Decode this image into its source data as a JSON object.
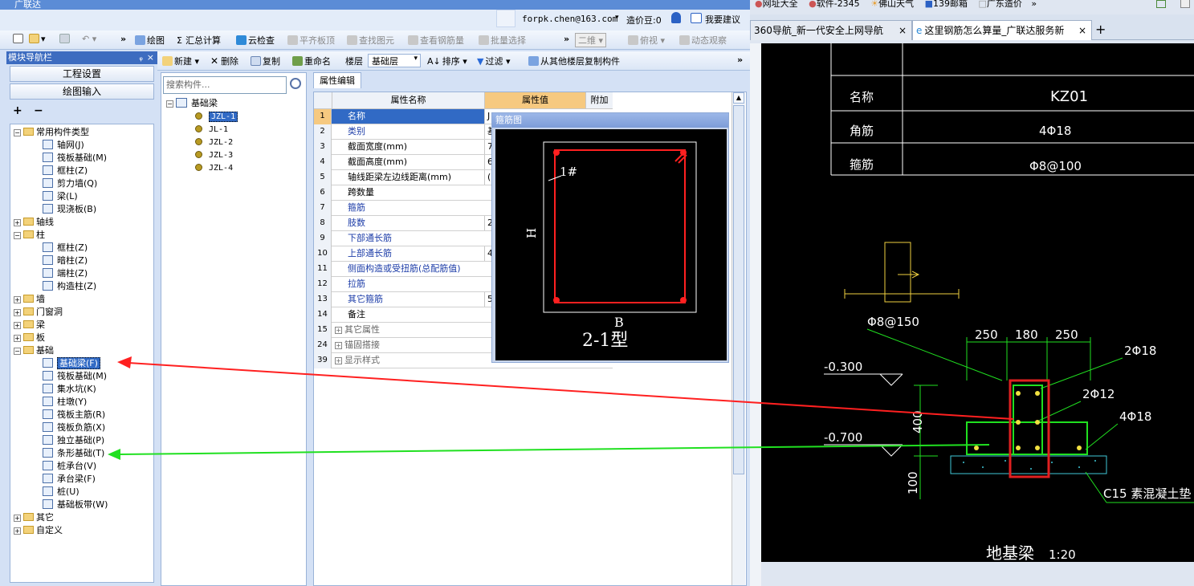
{
  "app": {
    "title": "广联达",
    "user_email": "forpk.chen@163.com",
    "cost_label": "造价豆:0",
    "suggest_label": "我要建议",
    "toolbar1": [
      "绘图",
      "汇总计算",
      "云检查",
      "平齐板顶",
      "查找图元",
      "查看钢筋量",
      "批量选择",
      "二维",
      "俯视",
      "动态观察"
    ],
    "toolbar2": {
      "new_label": "新建",
      "delete_label": "删除",
      "copy_label": "复制",
      "rename_label": "重命名",
      "floor_label": "楼层",
      "floor_value": "基础层",
      "sort_label": "排序",
      "filter_label": "过滤",
      "copy_from_label": "从其他楼层复制构件"
    }
  },
  "nav": {
    "title": "模块导航栏",
    "pin": "ᵩ",
    "close": "×",
    "btn_project": "工程设置",
    "btn_draw": "绘图输入",
    "expand_all": "+",
    "collapse_all": "−",
    "tree": [
      {
        "text": "常用构件类型",
        "level": 0,
        "exp": "−",
        "kind": "folder"
      },
      {
        "text": "轴网(J)",
        "level": 1,
        "kind": "comp"
      },
      {
        "text": "筏板基础(M)",
        "level": 1,
        "kind": "comp"
      },
      {
        "text": "框柱(Z)",
        "level": 1,
        "kind": "comp"
      },
      {
        "text": "剪力墙(Q)",
        "level": 1,
        "kind": "comp"
      },
      {
        "text": "梁(L)",
        "level": 1,
        "kind": "comp"
      },
      {
        "text": "现浇板(B)",
        "level": 1,
        "kind": "comp"
      },
      {
        "text": "轴线",
        "level": 0,
        "exp": "+",
        "kind": "folder"
      },
      {
        "text": "柱",
        "level": 0,
        "exp": "−",
        "kind": "folder"
      },
      {
        "text": "框柱(Z)",
        "level": 1,
        "kind": "comp"
      },
      {
        "text": "暗柱(Z)",
        "level": 1,
        "kind": "comp"
      },
      {
        "text": "端柱(Z)",
        "level": 1,
        "kind": "comp"
      },
      {
        "text": "构造柱(Z)",
        "level": 1,
        "kind": "comp"
      },
      {
        "text": "墙",
        "level": 0,
        "exp": "+",
        "kind": "folder"
      },
      {
        "text": "门窗洞",
        "level": 0,
        "exp": "+",
        "kind": "folder"
      },
      {
        "text": "梁",
        "level": 0,
        "exp": "+",
        "kind": "folder"
      },
      {
        "text": "板",
        "level": 0,
        "exp": "+",
        "kind": "folder"
      },
      {
        "text": "基础",
        "level": 0,
        "exp": "−",
        "kind": "folder"
      },
      {
        "text": "基础梁(F)",
        "level": 1,
        "kind": "comp",
        "selected": true
      },
      {
        "text": "筏板基础(M)",
        "level": 1,
        "kind": "comp"
      },
      {
        "text": "集水坑(K)",
        "level": 1,
        "kind": "comp"
      },
      {
        "text": "柱墩(Y)",
        "level": 1,
        "kind": "comp"
      },
      {
        "text": "筏板主筋(R)",
        "level": 1,
        "kind": "comp"
      },
      {
        "text": "筏板负筋(X)",
        "level": 1,
        "kind": "comp"
      },
      {
        "text": "独立基础(P)",
        "level": 1,
        "kind": "comp"
      },
      {
        "text": "条形基础(T)",
        "level": 1,
        "kind": "comp"
      },
      {
        "text": "桩承台(V)",
        "level": 1,
        "kind": "comp"
      },
      {
        "text": "承台梁(F)",
        "level": 1,
        "kind": "comp"
      },
      {
        "text": "桩(U)",
        "level": 1,
        "kind": "comp"
      },
      {
        "text": "基础板带(W)",
        "level": 1,
        "kind": "comp"
      },
      {
        "text": "其它",
        "level": 0,
        "exp": "+",
        "kind": "folder"
      },
      {
        "text": "自定义",
        "level": 0,
        "exp": "+",
        "kind": "folder"
      }
    ]
  },
  "components": {
    "search_placeholder": "搜索构件...",
    "root": "基础梁",
    "items": [
      "JZL-1",
      "JL-1",
      "JZL-2",
      "JZL-3",
      "JZL-4"
    ]
  },
  "props": {
    "tab": "属性编辑",
    "col_name": "属性名称",
    "col_value": "属性值",
    "col_extra": "附加",
    "rows": [
      {
        "n": "1",
        "k": "名称",
        "v": "J",
        "blue": false
      },
      {
        "n": "2",
        "k": "类别",
        "v": "基",
        "blue": true
      },
      {
        "n": "3",
        "k": "截面宽度(mm)",
        "v": "7",
        "blue": false
      },
      {
        "n": "4",
        "k": "截面高度(mm)",
        "v": "6",
        "blue": false
      },
      {
        "n": "5",
        "k": "轴线距梁左边线距离(mm)",
        "v": "(",
        "blue": false
      },
      {
        "n": "6",
        "k": "跨数量",
        "v": "",
        "blue": false
      },
      {
        "n": "7",
        "k": "箍筋",
        "v": "",
        "blue": true
      },
      {
        "n": "8",
        "k": "肢数",
        "v": "2",
        "blue": true
      },
      {
        "n": "9",
        "k": "下部通长筋",
        "v": "",
        "blue": true
      },
      {
        "n": "10",
        "k": "上部通长筋",
        "v": "4",
        "blue": true
      },
      {
        "n": "11",
        "k": "侧面构造或受扭筋(总配筋值)",
        "v": "",
        "blue": true
      },
      {
        "n": "12",
        "k": "拉筋",
        "v": "",
        "blue": true
      },
      {
        "n": "13",
        "k": "其它箍筋",
        "v": "5",
        "blue": true
      },
      {
        "n": "14",
        "k": "备注",
        "v": "",
        "blue": false
      },
      {
        "n": "15",
        "k": "其它属性",
        "v": "",
        "blue": false,
        "group": true
      },
      {
        "n": "24",
        "k": "锚固搭接",
        "v": "",
        "blue": false,
        "group": true
      },
      {
        "n": "39",
        "k": "显示样式",
        "v": "",
        "blue": false,
        "group": true
      }
    ]
  },
  "stirrup": {
    "title": "箍筋图",
    "label_h": "H",
    "label_b": "B",
    "label_1": "1#",
    "type": "2-1型"
  },
  "browser": {
    "favs": [
      "网址大全",
      "软件-2345",
      "佛山天气",
      "139邮箱",
      "广东造价",
      "»"
    ],
    "tabs": [
      "360导航_新一代安全上网导航",
      "这里钢筋怎么算量_广联达服务新"
    ],
    "close_tab": "×",
    "new_tab": "+"
  },
  "cad": {
    "table": [
      [
        "名称",
        "KZ01"
      ],
      [
        "角筋",
        "4Φ18"
      ],
      [
        "箍筋",
        "Φ8@100"
      ]
    ],
    "stirrup_spacing": "Φ8@150",
    "dims_top": [
      "250",
      "180",
      "250"
    ],
    "top_bars": "2Φ18",
    "mid_bars": "2Φ12",
    "bot_bars": "4Φ18",
    "elev1": "-0.300",
    "elev2": "-0.700",
    "h400": "400",
    "h100": "100",
    "concrete": "C15 素混凝土垫",
    "caption": "地基梁",
    "scale": "1:20"
  }
}
